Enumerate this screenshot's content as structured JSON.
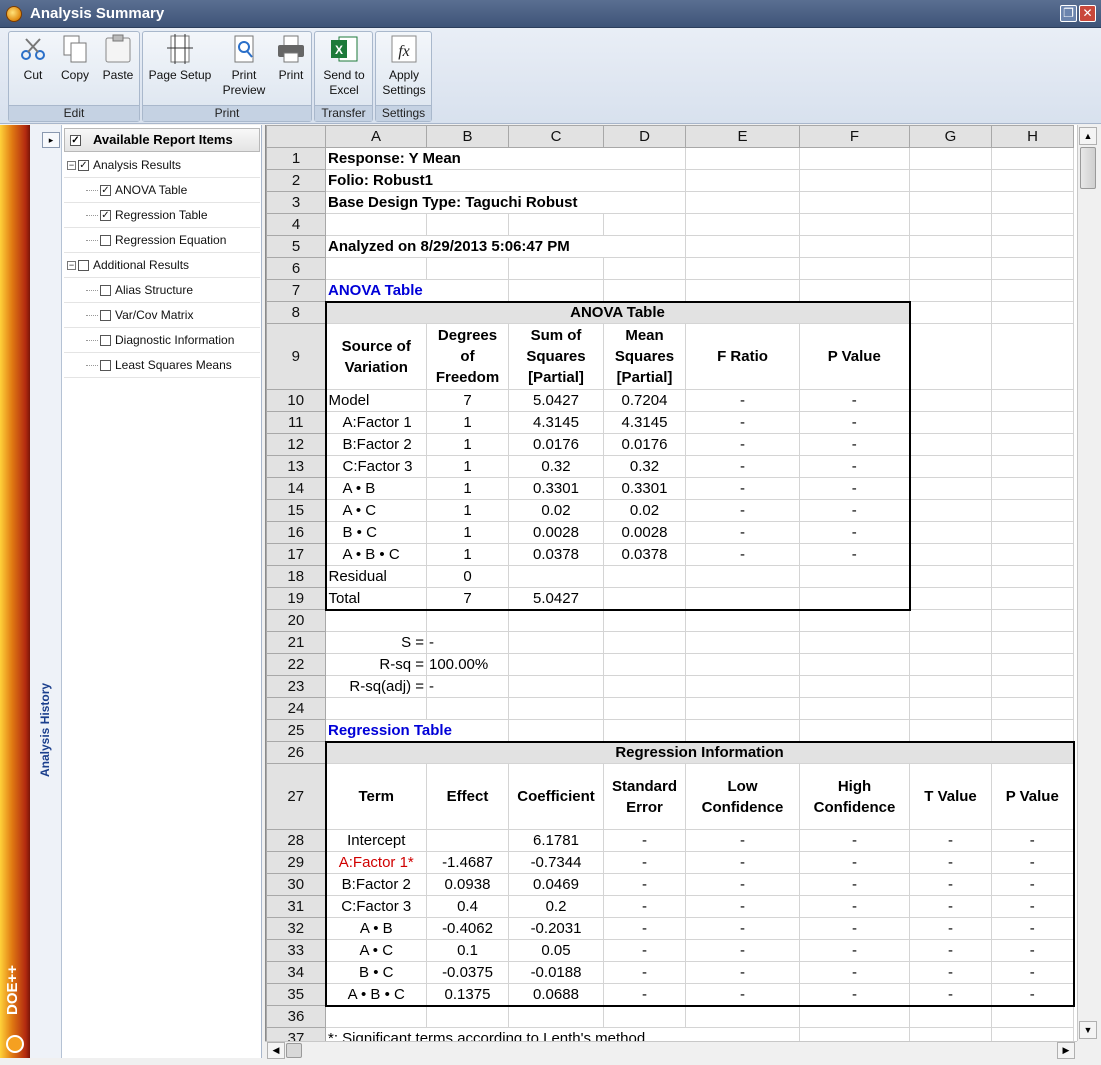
{
  "window": {
    "title": "Analysis Summary",
    "restore_glyph": "❐",
    "close_glyph": "✕"
  },
  "toolbar": {
    "groups": [
      {
        "label": "Edit",
        "buttons": [
          {
            "label": "Cut",
            "icon": "scissors-icon"
          },
          {
            "label": "Copy",
            "icon": "copy-icon"
          },
          {
            "label": "Paste",
            "icon": "paste-icon"
          }
        ]
      },
      {
        "label": "Print",
        "buttons": [
          {
            "label": "Page Setup",
            "icon": "page-setup-icon"
          },
          {
            "label": "Print Preview",
            "icon": "print-preview-icon"
          },
          {
            "label": "Print",
            "icon": "printer-icon"
          }
        ]
      },
      {
        "label": "Transfer",
        "buttons": [
          {
            "label": "Send to Excel",
            "icon": "excel-icon"
          }
        ]
      },
      {
        "label": "Settings",
        "buttons": [
          {
            "label": "Apply Settings",
            "icon": "fx-icon"
          }
        ]
      }
    ],
    "lines": {
      "print_preview_1": "Print",
      "print_preview_2": "Preview",
      "send_excel_1": "Send to",
      "send_excel_2": "Excel",
      "apply_settings_1": "Apply",
      "apply_settings_2": "Settings"
    }
  },
  "sidebar": {
    "history_label": "Analysis History",
    "brand": "DOE++"
  },
  "tree": {
    "header": "Available Report Items",
    "items": [
      {
        "label": "Analysis Results",
        "checked": true,
        "level": 0
      },
      {
        "label": "ANOVA Table",
        "checked": true,
        "level": 1
      },
      {
        "label": "Regression Table",
        "checked": true,
        "level": 1
      },
      {
        "label": "Regression Equation",
        "checked": false,
        "level": 1
      },
      {
        "label": "Additional Results",
        "checked": false,
        "level": 0
      },
      {
        "label": "Alias Structure",
        "checked": false,
        "level": 1
      },
      {
        "label": "Var/Cov Matrix",
        "checked": false,
        "level": 1
      },
      {
        "label": "Diagnostic Information",
        "checked": false,
        "level": 1
      },
      {
        "label": "Least Squares Means",
        "checked": false,
        "level": 1
      }
    ]
  },
  "sheet": {
    "columns": [
      "A",
      "B",
      "C",
      "D",
      "E",
      "F",
      "G",
      "H"
    ],
    "response": "Response: Y Mean",
    "folio": "Folio: Robust1",
    "design": "Base Design Type: Taguchi Robust",
    "analyzed": "Analyzed on 8/29/2013 5:06:47 PM",
    "anova_heading": "ANOVA Table",
    "anova_title": "ANOVA Table",
    "anova_headers": [
      "Source of Variation",
      "Degrees of Freedom",
      "Sum of Squares [Partial]",
      "Mean Squares [Partial]",
      "F Ratio",
      "P Value"
    ],
    "anova_rows": [
      [
        "Model",
        "7",
        "5.0427",
        "0.7204",
        "-",
        "-"
      ],
      [
        "A:Factor 1",
        "1",
        "4.3145",
        "4.3145",
        "-",
        "-"
      ],
      [
        "B:Factor 2",
        "1",
        "0.0176",
        "0.0176",
        "-",
        "-"
      ],
      [
        "C:Factor 3",
        "1",
        "0.32",
        "0.32",
        "-",
        "-"
      ],
      [
        "A • B",
        "1",
        "0.3301",
        "0.3301",
        "-",
        "-"
      ],
      [
        "A • C",
        "1",
        "0.02",
        "0.02",
        "-",
        "-"
      ],
      [
        "B • C",
        "1",
        "0.0028",
        "0.0028",
        "-",
        "-"
      ],
      [
        "A • B • C",
        "1",
        "0.0378",
        "0.0378",
        "-",
        "-"
      ],
      [
        "Residual",
        "0",
        "",
        "",
        "",
        ""
      ],
      [
        "Total",
        "7",
        "5.0427",
        "",
        "",
        ""
      ]
    ],
    "s_label": "S =",
    "s_value": "-",
    "rsq_label": "R-sq =",
    "rsq_value": "100.00%",
    "rsqadj_label": "R-sq(adj) =",
    "rsqadj_value": "-",
    "regression_heading": "Regression Table",
    "regression_title": "Regression Information",
    "regression_headers": [
      "Term",
      "Effect",
      "Coefficient",
      "Standard Error",
      "Low Confidence",
      "High Confidence",
      "T Value",
      "P Value"
    ],
    "regression_rows": [
      [
        "Intercept",
        "",
        "6.1781",
        "-",
        "-",
        "-",
        "-",
        "-"
      ],
      [
        "A:Factor 1*",
        "-1.4687",
        "-0.7344",
        "-",
        "-",
        "-",
        "-",
        "-"
      ],
      [
        "B:Factor 2",
        "0.0938",
        "0.0469",
        "-",
        "-",
        "-",
        "-",
        "-"
      ],
      [
        "C:Factor 3",
        "0.4",
        "0.2",
        "-",
        "-",
        "-",
        "-",
        "-"
      ],
      [
        "A • B",
        "-0.4062",
        "-0.2031",
        "-",
        "-",
        "-",
        "-",
        "-"
      ],
      [
        "A • C",
        "0.1",
        "0.05",
        "-",
        "-",
        "-",
        "-",
        "-"
      ],
      [
        "B • C",
        "-0.0375",
        "-0.0188",
        "-",
        "-",
        "-",
        "-",
        "-"
      ],
      [
        "A • B • C",
        "0.1375",
        "0.0688",
        "-",
        "-",
        "-",
        "-",
        "-"
      ]
    ],
    "significant_term_color": "#d00000",
    "footnote": "*: Significant terms according to Lenth's method"
  },
  "colors": {
    "heading_blue": "#0000d8",
    "title_bar": "#3e5478",
    "toolbar": "#d8e1ee"
  }
}
